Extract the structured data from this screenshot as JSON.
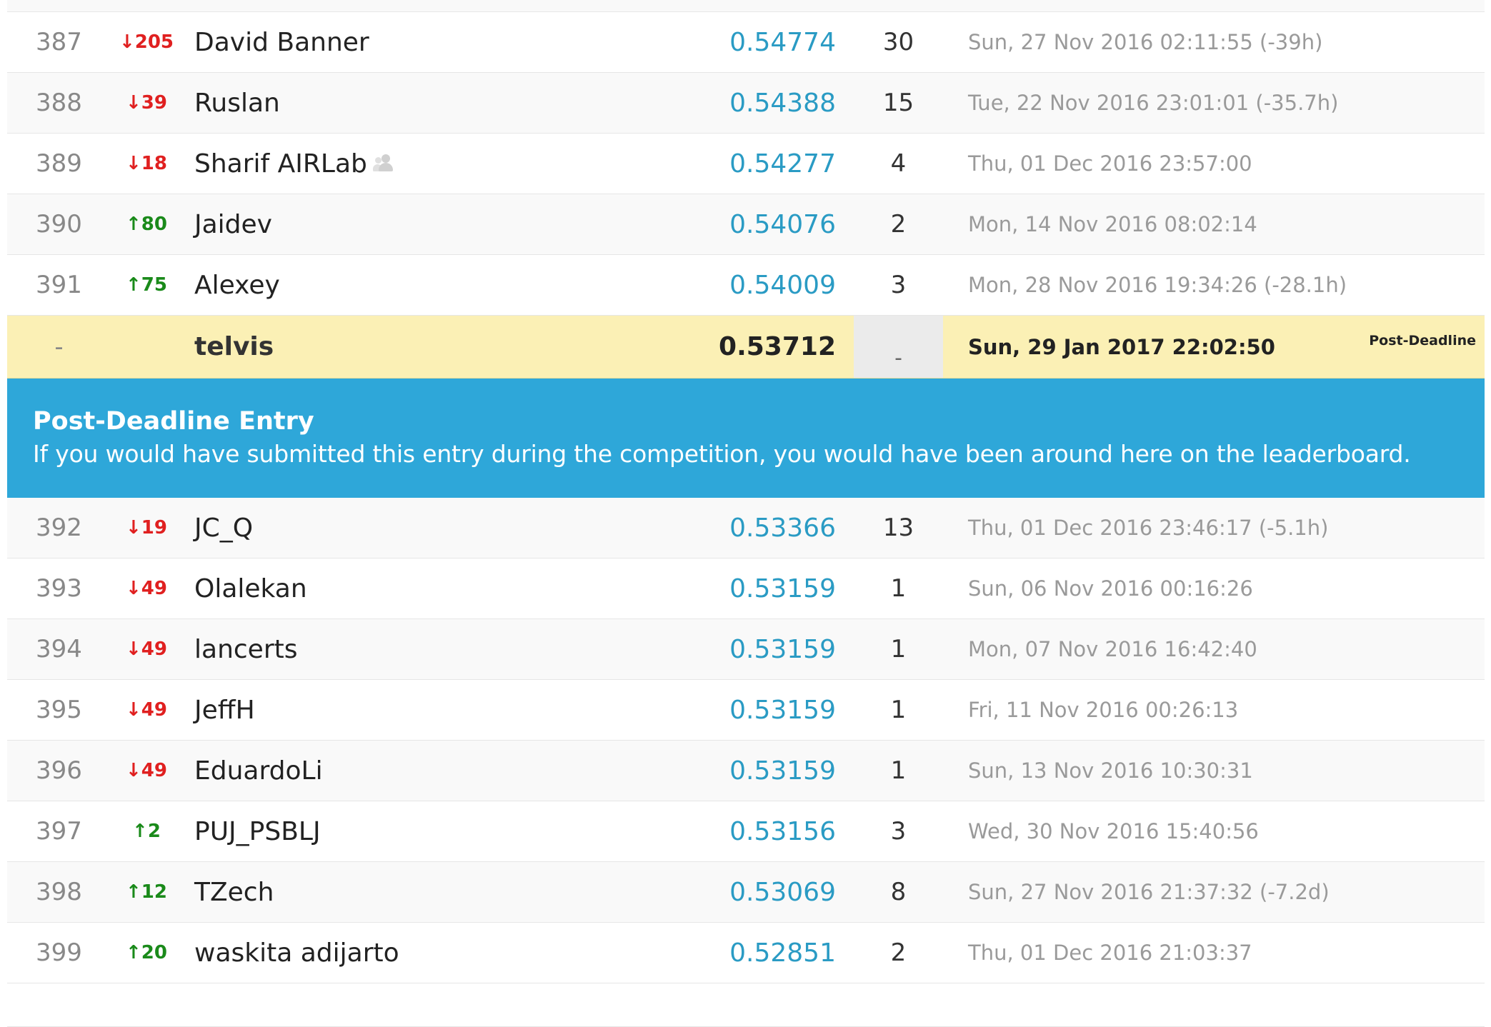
{
  "rows_above": [
    {
      "rank": "387",
      "delta_dir": "down",
      "delta": "205",
      "name": "David Banner",
      "team": false,
      "score": "0.54774",
      "entries": "30",
      "last": "Sun, 27 Nov 2016 02:11:55 (-39h)"
    },
    {
      "rank": "388",
      "delta_dir": "down",
      "delta": "39",
      "name": "Ruslan",
      "team": false,
      "score": "0.54388",
      "entries": "15",
      "last": "Tue, 22 Nov 2016 23:01:01 (-35.7h)"
    },
    {
      "rank": "389",
      "delta_dir": "down",
      "delta": "18",
      "name": "Sharif AIRLab",
      "team": true,
      "score": "0.54277",
      "entries": "4",
      "last": "Thu, 01 Dec 2016 23:57:00"
    },
    {
      "rank": "390",
      "delta_dir": "up",
      "delta": "80",
      "name": "Jaidev",
      "team": false,
      "score": "0.54076",
      "entries": "2",
      "last": "Mon, 14 Nov 2016 08:02:14"
    },
    {
      "rank": "391",
      "delta_dir": "up",
      "delta": "75",
      "name": "Alexey",
      "team": false,
      "score": "0.54009",
      "entries": "3",
      "last": "Mon, 28 Nov 2016 19:34:26 (-28.1h)"
    }
  ],
  "your_entry": {
    "rank": "-",
    "name": "telvis",
    "score": "0.53712",
    "entries": "-",
    "last": "Sun, 29 Jan 2017 22:02:50",
    "tag": "Post-Deadline"
  },
  "banner": {
    "title": "Post-Deadline Entry",
    "text": "If you would have submitted this entry during the competition, you would have been around here on the leaderboard."
  },
  "rows_below": [
    {
      "rank": "392",
      "delta_dir": "down",
      "delta": "19",
      "name": "JC_Q",
      "team": false,
      "score": "0.53366",
      "entries": "13",
      "last": "Thu, 01 Dec 2016 23:46:17 (-5.1h)"
    },
    {
      "rank": "393",
      "delta_dir": "down",
      "delta": "49",
      "name": "Olalekan",
      "team": false,
      "score": "0.53159",
      "entries": "1",
      "last": "Sun, 06 Nov 2016 00:16:26"
    },
    {
      "rank": "394",
      "delta_dir": "down",
      "delta": "49",
      "name": "lancerts",
      "team": false,
      "score": "0.53159",
      "entries": "1",
      "last": "Mon, 07 Nov 2016 16:42:40"
    },
    {
      "rank": "395",
      "delta_dir": "down",
      "delta": "49",
      "name": "JeffH",
      "team": false,
      "score": "0.53159",
      "entries": "1",
      "last": "Fri, 11 Nov 2016 00:26:13"
    },
    {
      "rank": "396",
      "delta_dir": "down",
      "delta": "49",
      "name": "EduardoLi",
      "team": false,
      "score": "0.53159",
      "entries": "1",
      "last": "Sun, 13 Nov 2016 10:30:31"
    },
    {
      "rank": "397",
      "delta_dir": "up",
      "delta": "2",
      "name": "PUJ_PSBLJ",
      "team": false,
      "score": "0.53156",
      "entries": "3",
      "last": "Wed, 30 Nov 2016 15:40:56"
    },
    {
      "rank": "398",
      "delta_dir": "up",
      "delta": "12",
      "name": "TZech",
      "team": false,
      "score": "0.53069",
      "entries": "8",
      "last": "Sun, 27 Nov 2016 21:37:32 (-7.2d)"
    },
    {
      "rank": "399",
      "delta_dir": "up",
      "delta": "20",
      "name": "waskita adijarto",
      "team": false,
      "score": "0.52851",
      "entries": "2",
      "last": "Thu, 01 Dec 2016 21:03:37"
    }
  ],
  "arrows": {
    "up": "↑",
    "down": "↓"
  }
}
